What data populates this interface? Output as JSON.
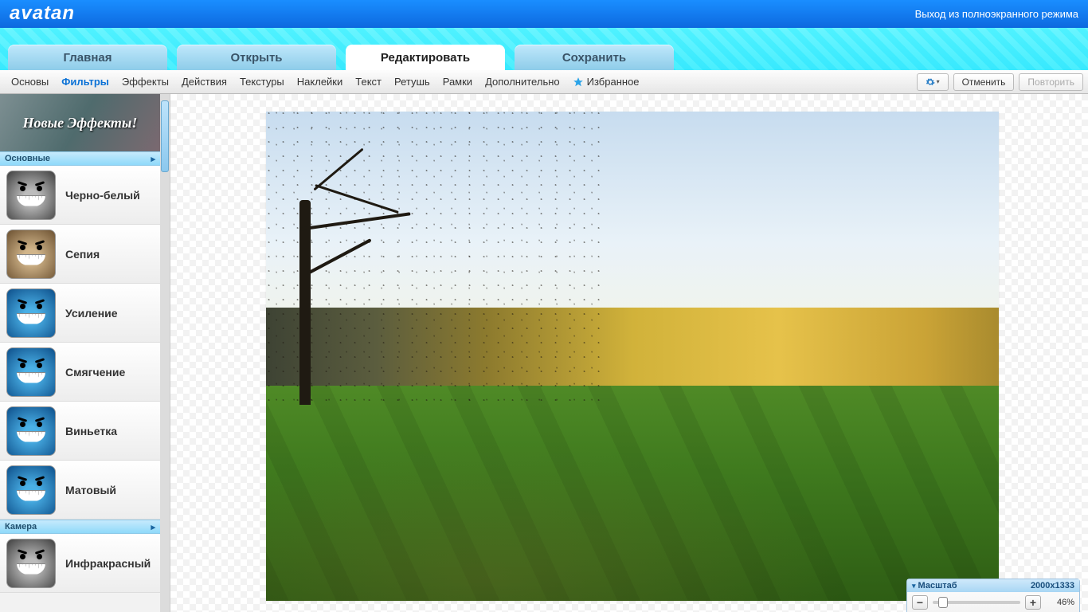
{
  "brand": "avatan",
  "exit_fullscreen": "Выход из полноэкранного режима",
  "main_tabs": {
    "home": "Главная",
    "open": "Открыть",
    "edit": "Редактировать",
    "save": "Сохранить"
  },
  "toolbar": {
    "items": {
      "basics": "Основы",
      "filters": "Фильтры",
      "effects": "Эффекты",
      "actions": "Действия",
      "textures": "Текстуры",
      "stickers": "Наклейки",
      "text": "Текст",
      "retouch": "Ретушь",
      "frames": "Рамки",
      "more": "Дополнительно"
    },
    "favorites": "Избранное",
    "undo": "Отменить",
    "redo": "Повторить"
  },
  "sidebar": {
    "promo": "Новые Эффекты!",
    "cat_main": "Основные",
    "cat_camera": "Камера",
    "filters": {
      "bw": "Черно-белый",
      "sepia": "Сепия",
      "boost": "Усиление",
      "soften": "Смягчение",
      "vignette": "Виньетка",
      "matte": "Матовый",
      "infrared": "Инфракрасный"
    }
  },
  "zoom": {
    "label": "Масштаб",
    "dims": "2000x1333",
    "percent": "46%"
  }
}
